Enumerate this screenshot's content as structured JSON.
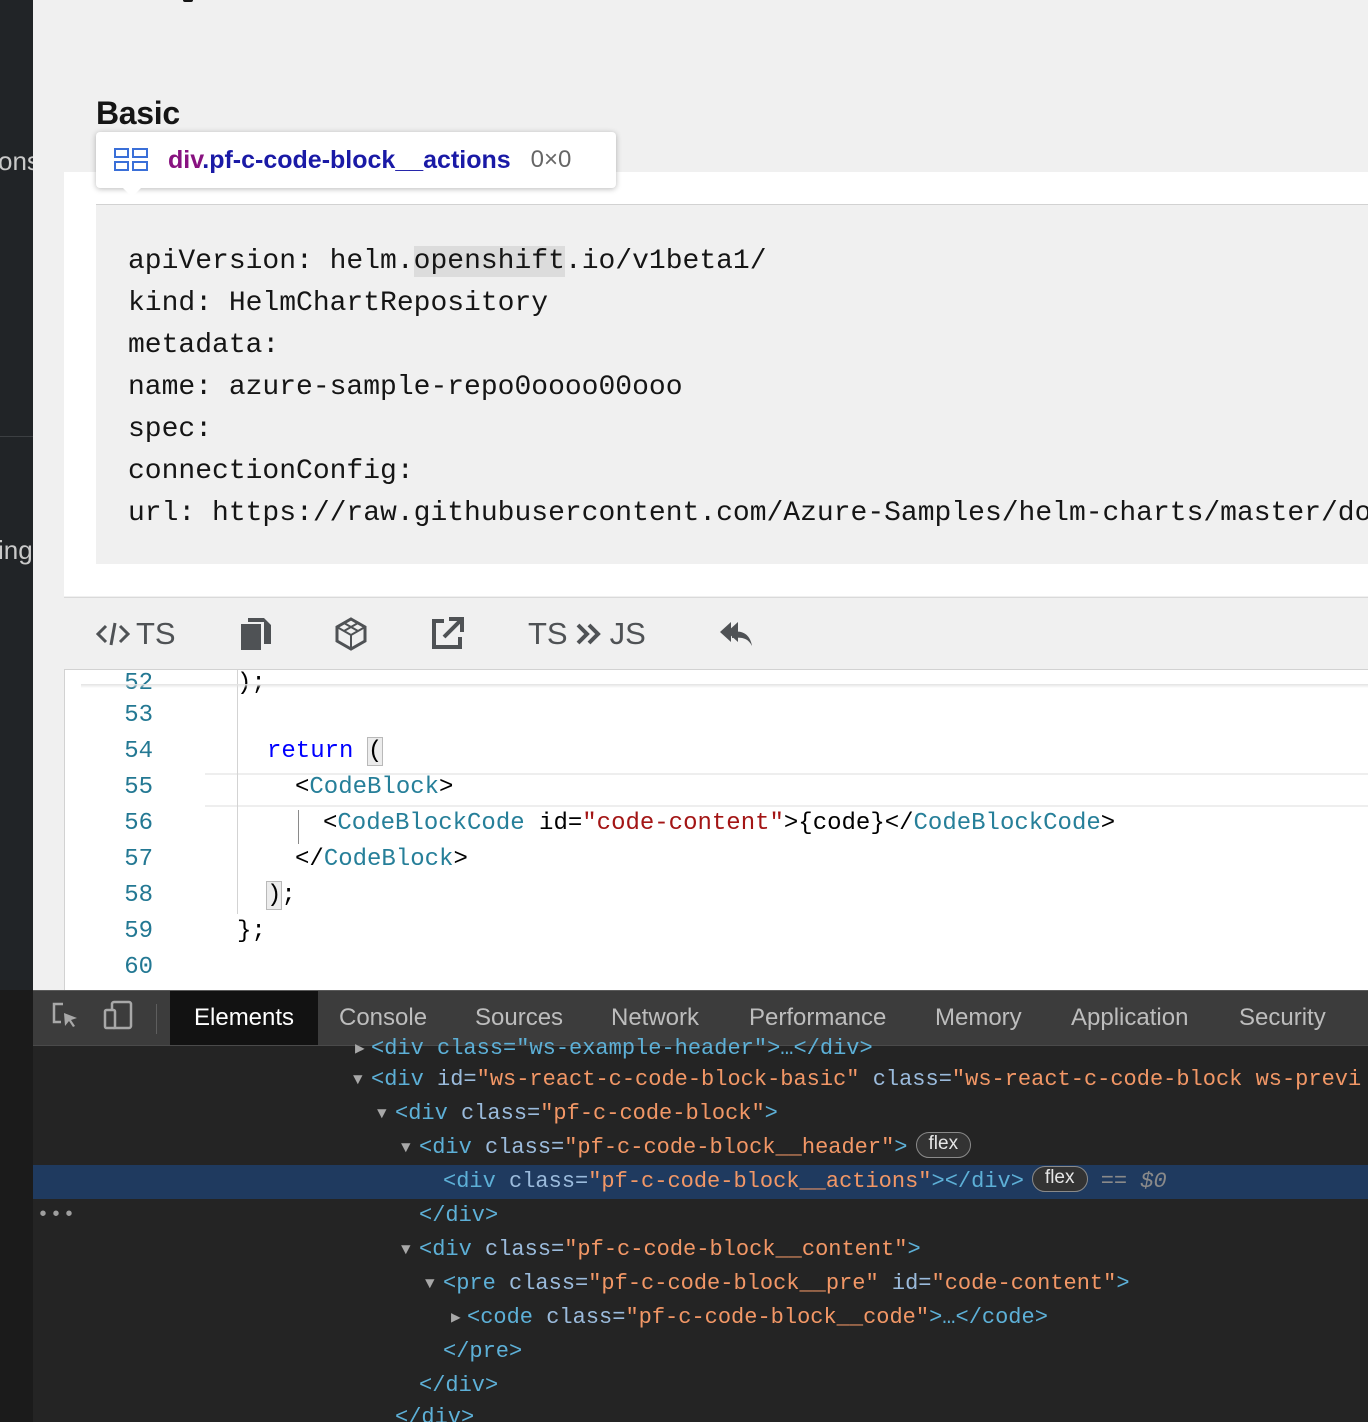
{
  "sidebar": {
    "fragments": [
      "ons",
      "ing"
    ]
  },
  "page": {
    "section_title": "Basic"
  },
  "tooltip": {
    "tag": "div",
    "class": ".pf-c-code-block__actions",
    "size": "0×0"
  },
  "code_block": {
    "lines": [
      "apiVersion: helm.",
      "openshift",
      ".io/v1beta1/",
      "kind: HelmChartRepository",
      "metadata:",
      "name: azure-sample-repo0oooo00ooo",
      "spec:",
      "connectionConfig:",
      "url: https://raw.githubusercontent.com/Azure-Samples/helm-charts/master/do"
    ]
  },
  "toolbar": {
    "ts_label": "TS",
    "convert_from": "TS",
    "convert_to": "JS",
    "icons": [
      "code-icon",
      "copy-icon",
      "codesandbox-icon",
      "external-link-icon",
      "convert-icon",
      "undo-icon"
    ]
  },
  "editor": {
    "line_numbers": [
      "53",
      "54",
      "55",
      "56",
      "57",
      "58",
      "59",
      "60"
    ],
    "partial_line_number": "52",
    "partial_line_text": ");",
    "return_kw": "return",
    "open_paren": "(",
    "codeblock_tag": "CodeBlock",
    "codeblockcode_tag": "CodeBlockCode",
    "id_attr": "id=",
    "id_value": "\"code-content\"",
    "code_expr": ">{code}</",
    "close_paren": ")",
    "semicolon": ";",
    "close_brace": "};"
  },
  "devtools": {
    "tabs": [
      "Elements",
      "Console",
      "Sources",
      "Network",
      "Performance",
      "Memory",
      "Application",
      "Security"
    ],
    "active_tab": "Elements",
    "rows": {
      "r0": "<div class=\"ws-example-header\">…</div>",
      "r1_tag": "<div ",
      "r1_a1": "id=",
      "r1_v1": "\"ws-react-c-code-block-basic\"",
      "r1_a2": " class=",
      "r1_v2": "\"ws-react-c-code-block ws-previ",
      "r2_tag": "<div ",
      "r2_a": "class=",
      "r2_v": "\"pf-c-code-block\"",
      "r3_tag": "<div ",
      "r3_a": "class=",
      "r3_v": "\"pf-c-code-block__header\"",
      "r4_tag": "<div ",
      "r4_a": "class=",
      "r4_v": "\"pf-c-code-block__actions\"",
      "r4_close": "></div>",
      "selected_marker": "== $0",
      "r5": "</div>",
      "r6_tag": "<div ",
      "r6_a": "class=",
      "r6_v": "\"pf-c-code-block__content\"",
      "r7_tag": "<pre ",
      "r7_a1": "class=",
      "r7_v1": "\"pf-c-code-block__pre\"",
      "r7_a2": " id=",
      "r7_v2": "\"code-content\"",
      "r8_tag": "<code ",
      "r8_a": "class=",
      "r8_v": "\"pf-c-code-block__code\"",
      "r8_rest": ">…</code>",
      "r9": "</pre>",
      "r10": "</div>",
      "r11": "</div>",
      "gt": ">",
      "badge": "flex",
      "ellipsis": "•••"
    }
  },
  "colors": {
    "sidebar": "#212427",
    "page_bg": "#f0f0f0",
    "devtools_bg": "#242424",
    "devtools_selected": "#1f3a5f",
    "line_number": "#237893",
    "keyword": "#0000ff",
    "jsx_tag": "#267f99",
    "string": "#a31515"
  }
}
